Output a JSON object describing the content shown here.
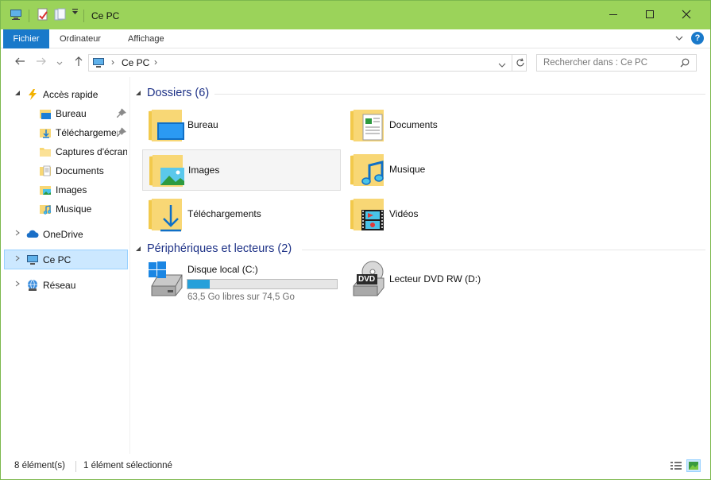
{
  "window": {
    "title": "Ce PC",
    "accent": "#9bd35a",
    "minimize_label": "Réduire",
    "maximize_label": "Agrandir",
    "close_label": "Fermer"
  },
  "ribbon": {
    "tabs": [
      {
        "label": "Fichier",
        "active": true
      },
      {
        "label": "Ordinateur"
      },
      {
        "label": "Affichage"
      }
    ],
    "help": "?"
  },
  "address": {
    "location": "Ce PC"
  },
  "search": {
    "placeholder": "Rechercher dans : Ce PC"
  },
  "sidebar": {
    "quick_access": {
      "label": "Accès rapide",
      "items": [
        {
          "label": "Bureau",
          "icon": "desktop-folder-icon",
          "pinned": true
        },
        {
          "label": "Téléchargements",
          "icon": "downloads-folder-icon",
          "pinned": true
        },
        {
          "label": "Captures d'écran",
          "icon": "folder-icon"
        },
        {
          "label": "Documents",
          "icon": "documents-folder-icon"
        },
        {
          "label": "Images",
          "icon": "pictures-folder-icon"
        },
        {
          "label": "Musique",
          "icon": "music-folder-icon"
        }
      ]
    },
    "onedrive": {
      "label": "OneDrive"
    },
    "this_pc": {
      "label": "Ce PC",
      "selected": true
    },
    "network": {
      "label": "Réseau"
    }
  },
  "content": {
    "folders_group": "Dossiers (6)",
    "folders": [
      {
        "label": "Bureau",
        "icon": "desktop-folder-icon"
      },
      {
        "label": "Documents",
        "icon": "documents-folder-icon"
      },
      {
        "label": "Images",
        "icon": "pictures-folder-icon",
        "hovered": true
      },
      {
        "label": "Musique",
        "icon": "music-folder-icon"
      },
      {
        "label": "Téléchargements",
        "icon": "downloads-folder-icon"
      },
      {
        "label": "Vidéos",
        "icon": "videos-folder-icon"
      }
    ],
    "devices_group": "Périphériques et lecteurs (2)",
    "drives": [
      {
        "label": "Disque local (C:)",
        "free_text": "63,5 Go libres sur 74,5 Go",
        "used_fraction": 0.148
      },
      {
        "label": "Lecteur DVD RW (D:)",
        "badge": "DVD"
      }
    ]
  },
  "status": {
    "count": "8 élément(s)",
    "selection": "1 élément sélectionné"
  }
}
